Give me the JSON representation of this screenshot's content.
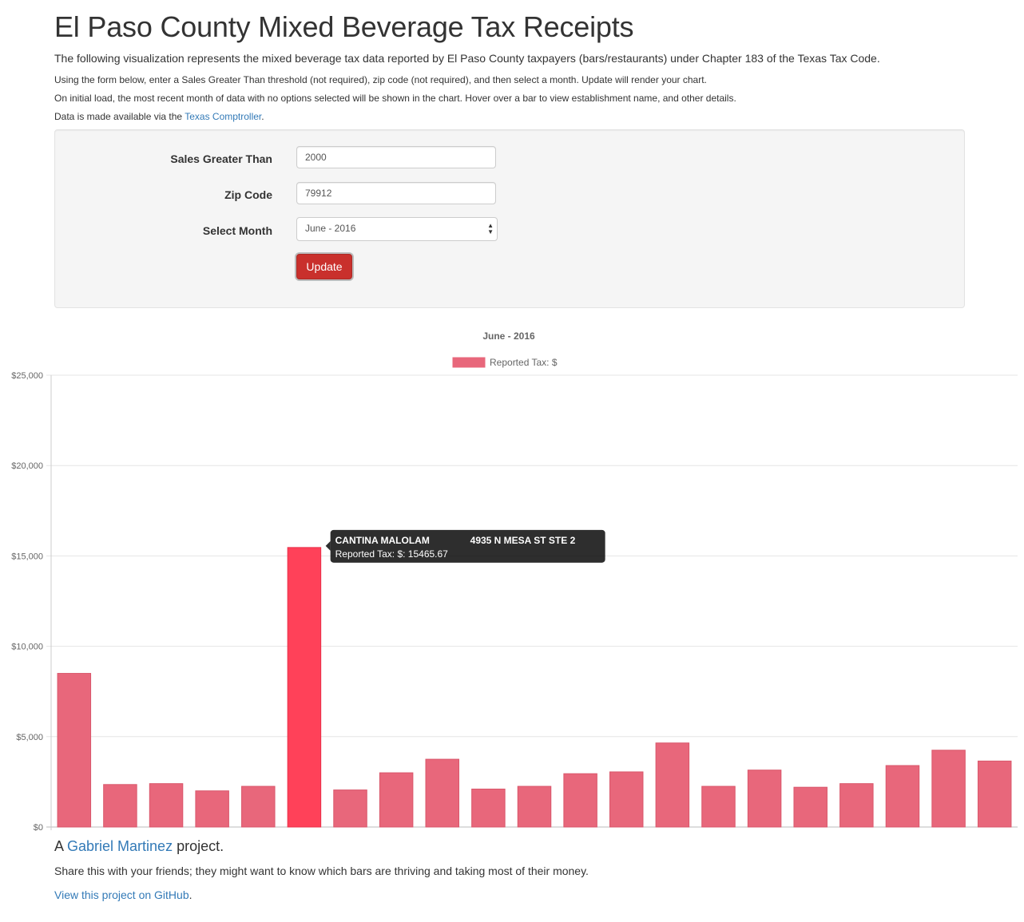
{
  "header": {
    "title": "El Paso County Mixed Beverage Tax Receipts",
    "lead": "The following visualization represents the mixed beverage tax data reported by El Paso County taxpayers (bars/restaurants) under Chapter 183 of the Texas Tax Code.",
    "instructions": "Using the form below, enter a Sales Greater Than threshold (not required), zip code (not required), and then select a month. Update will render your chart.",
    "initial_load_note": "On initial load, the most recent month of data with no options selected will be shown in the chart. Hover over a bar to view establishment name, and other details.",
    "source_prefix": "Data is made available via the ",
    "source_link": "Texas Comptroller",
    "source_suffix": "."
  },
  "form": {
    "sales_label": "Sales Greater Than",
    "sales_value": "2000",
    "zip_label": "Zip Code",
    "zip_value": "79912",
    "month_label": "Select Month",
    "month_value": "June - 2016",
    "update_label": "Update",
    "update_color": "#c9302c"
  },
  "chart_data": {
    "type": "bar",
    "title": "June - 2016",
    "legend": [
      "Reported Tax: $"
    ],
    "legend_placement": "top",
    "bar_color": "#e8677b",
    "highlight_color": "#ff4159",
    "y_ticks": [
      "$0",
      "$5,000",
      "$10,000",
      "$15,000",
      "$20,000",
      "$25,000"
    ],
    "ylim": [
      0,
      25000
    ],
    "grid": true,
    "series": [
      {
        "name": "Reported Tax: $",
        "values": [
          8500,
          2350,
          2400,
          2000,
          2250,
          15465.67,
          2050,
          3000,
          3750,
          2100,
          2250,
          2950,
          3050,
          4650,
          2250,
          3150,
          2200,
          2400,
          3400,
          4250,
          3650
        ]
      }
    ],
    "active_index": 5,
    "tooltip": {
      "name": "CANTINA MALOLAM",
      "address": "4935 N MESA ST STE 2",
      "value_line": "Reported Tax: $: 15465.67"
    }
  },
  "footer": {
    "prefix": "A ",
    "author": "Gabriel Martinez",
    "suffix": " project.",
    "share": "Share this with your friends; they might want to know which bars are thriving and taking most of their money.",
    "github_link": "View this project on GitHub",
    "github_suffix": "."
  }
}
